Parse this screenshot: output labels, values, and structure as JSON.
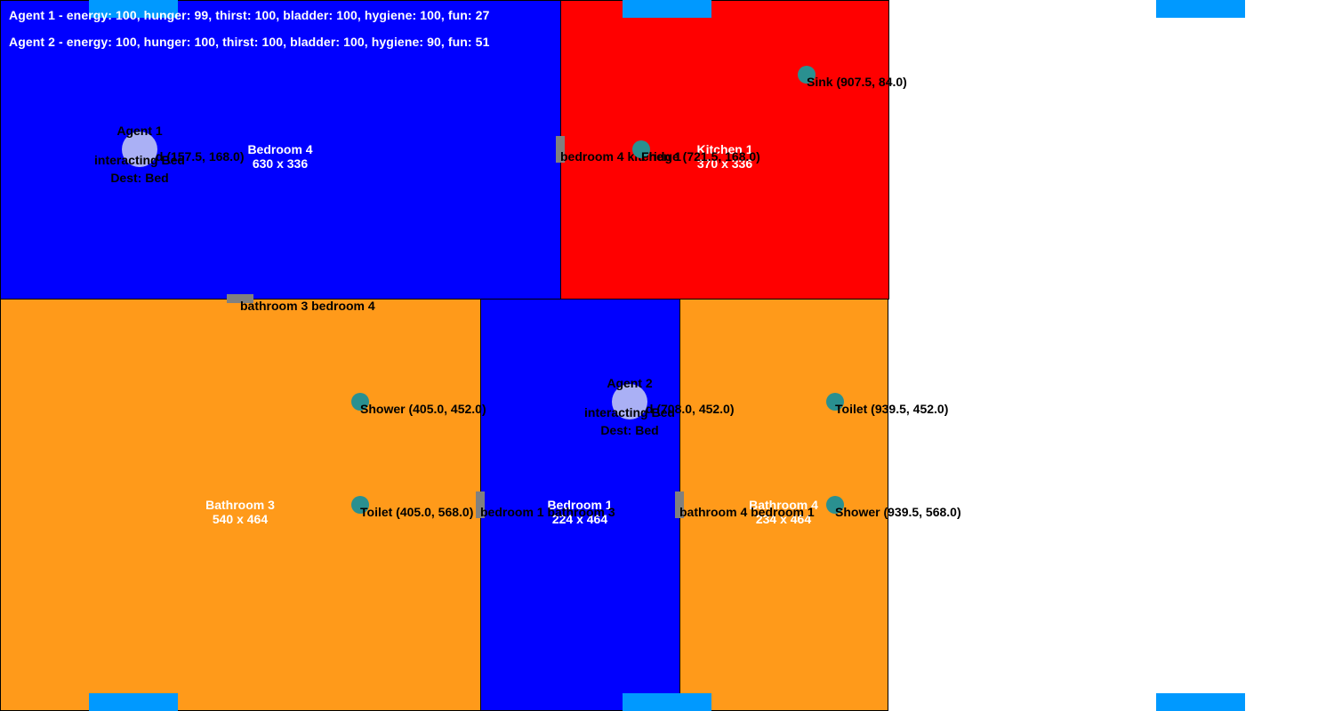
{
  "colors": {
    "bedroom": "#0000ff",
    "kitchen": "#ff0000",
    "bathroom": "#ff9a1a",
    "door": "#808080",
    "object": "#2a9090",
    "agent": "#aab0f5",
    "spawn": "#0099ff"
  },
  "status": {
    "agent1": "Agent 1 - energy: 100, hunger: 99, thirst: 100, bladder: 100, hygiene: 100, fun: 27",
    "agent2": "Agent 2 - energy: 100, hunger: 100, thirst: 100, bladder: 100, hygiene: 90, fun: 51"
  },
  "rooms": {
    "bedroom4": {
      "name": "Bedroom 4",
      "size": "630 x 336"
    },
    "kitchen1": {
      "name": "Kitchen 1",
      "size": "370 x 336"
    },
    "bathroom3": {
      "name": "Bathroom 3",
      "size": "540 x 464"
    },
    "bedroom1": {
      "name": "Bedroom 1",
      "size": "224 x 464"
    },
    "bathroom4": {
      "name": "Bathroom 4",
      "size": "234 x 464"
    }
  },
  "doors": {
    "bedroom4_kitchen1": "bedroom 4 kitchen 1",
    "bathroom3_bedroom4": "bathroom 3 bedroom 4",
    "bedroom1_bathroom3": "bedroom 1 bathroom 3",
    "bathroom4_bedroom1": "bathroom 4 bedroom 1"
  },
  "objects": {
    "sink": "Sink (907.5, 84.0)",
    "fridge": "Fridge (721.5, 168.0)",
    "bed4": "Bed (157.5, 168.0)",
    "shower3": "Shower (405.0, 452.0)",
    "toilet3": "Toilet (405.0, 568.0)",
    "bed1": "Bed (708.0, 452.0)",
    "toilet4": "Toilet (939.5, 452.0)",
    "shower4": "Shower (939.5, 568.0)"
  },
  "agents": {
    "agent1": {
      "name": "Agent 1",
      "action": "interacting Bed",
      "dest": "Dest: Bed"
    },
    "agent2": {
      "name": "Agent 2",
      "action": "interacting Bed",
      "dest": "Dest: Bed"
    }
  }
}
